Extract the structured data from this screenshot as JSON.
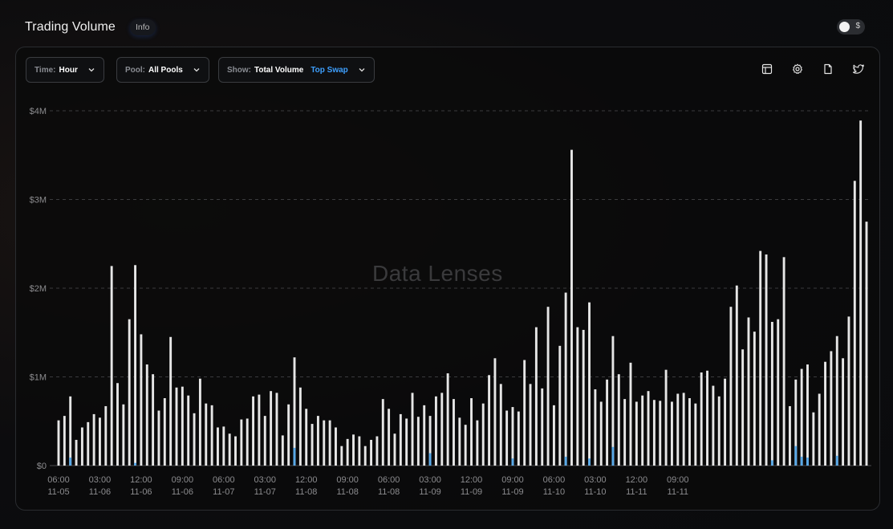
{
  "header": {
    "title": "Trading Volume",
    "info_label": "Info",
    "currency_symbol": "$"
  },
  "filters": {
    "time": {
      "label": "Time:",
      "value": "Hour"
    },
    "pool": {
      "label": "Pool:",
      "value": "All Pools"
    },
    "show": {
      "label": "Show:",
      "value": "Total Volume",
      "accent": "Top Swap"
    }
  },
  "toolbar": {
    "icons": [
      "table-icon",
      "gear-icon",
      "document-icon",
      "twitter-icon"
    ]
  },
  "watermark": "Data Lenses",
  "colors": {
    "total_volume": "#e6e6e6",
    "top_swap": "#59a9e8",
    "accent": "#3ea0ff",
    "grid": "#3b3b3e",
    "axis_text": "#8c8c8f"
  },
  "chart_data": {
    "type": "bar",
    "ylim": [
      0,
      4000000
    ],
    "yticks": [
      {
        "value": 0,
        "label": "$0"
      },
      {
        "value": 1000000,
        "label": "$1M"
      },
      {
        "value": 2000000,
        "label": "$2M"
      },
      {
        "value": 3000000,
        "label": "$3M"
      },
      {
        "value": 4000000,
        "label": "$4M"
      }
    ],
    "xticks": [
      {
        "index": 0,
        "time": "06:00",
        "date": "11-05"
      },
      {
        "index": 7,
        "time": "03:00",
        "date": "11-06"
      },
      {
        "index": 14,
        "time": "12:00",
        "date": "11-06"
      },
      {
        "index": 21,
        "time": "09:00",
        "date": "11-06"
      },
      {
        "index": 28,
        "time": "06:00",
        "date": "11-07"
      },
      {
        "index": 35,
        "time": "03:00",
        "date": "11-07"
      },
      {
        "index": 42,
        "time": "12:00",
        "date": "11-08"
      },
      {
        "index": 49,
        "time": "09:00",
        "date": "11-08"
      },
      {
        "index": 56,
        "time": "06:00",
        "date": "11-08"
      },
      {
        "index": 63,
        "time": "03:00",
        "date": "11-09"
      },
      {
        "index": 70,
        "time": "12:00",
        "date": "11-09"
      },
      {
        "index": 77,
        "time": "09:00",
        "date": "11-09"
      },
      {
        "index": 84,
        "time": "06:00",
        "date": "11-10"
      },
      {
        "index": 91,
        "time": "03:00",
        "date": "11-10"
      },
      {
        "index": 98,
        "time": "12:00",
        "date": "11-11"
      },
      {
        "index": 105,
        "time": "09:00",
        "date": "11-11"
      }
    ],
    "series": [
      {
        "name": "Total Volume",
        "values": [
          510000,
          560000,
          780000,
          290000,
          430000,
          490000,
          580000,
          540000,
          670000,
          2250000,
          930000,
          690000,
          1650000,
          2260000,
          1480000,
          1140000,
          1030000,
          620000,
          760000,
          1450000,
          880000,
          890000,
          790000,
          590000,
          980000,
          700000,
          680000,
          430000,
          440000,
          360000,
          330000,
          520000,
          530000,
          780000,
          800000,
          560000,
          840000,
          820000,
          340000,
          690000,
          1220000,
          880000,
          640000,
          470000,
          560000,
          510000,
          510000,
          430000,
          220000,
          300000,
          350000,
          330000,
          220000,
          290000,
          330000,
          750000,
          640000,
          360000,
          580000,
          530000,
          820000,
          550000,
          680000,
          560000,
          780000,
          820000,
          1040000,
          750000,
          540000,
          460000,
          760000,
          510000,
          700000,
          1020000,
          1210000,
          920000,
          620000,
          660000,
          610000,
          1190000,
          920000,
          1560000,
          870000,
          1790000,
          680000,
          1350000,
          1950000,
          3560000,
          1560000,
          1530000,
          1840000,
          860000,
          720000,
          970000,
          1460000,
          1030000,
          750000,
          1160000,
          720000,
          790000,
          840000,
          740000,
          730000,
          1080000,
          720000,
          810000,
          820000,
          760000,
          700000,
          1050000,
          1070000,
          900000,
          780000,
          980000,
          1790000,
          2030000,
          1310000,
          1670000,
          1510000,
          2420000,
          2380000,
          1620000,
          1650000,
          2350000,
          670000,
          970000,
          1090000,
          1140000,
          600000,
          810000,
          1170000,
          1290000,
          1460000,
          1210000,
          1680000,
          3210000,
          3890000,
          2750000
        ]
      },
      {
        "name": "Top Swap",
        "values": [
          0,
          0,
          90000,
          0,
          0,
          0,
          0,
          0,
          0,
          0,
          0,
          0,
          0,
          30000,
          0,
          0,
          0,
          0,
          0,
          0,
          0,
          0,
          0,
          0,
          0,
          0,
          0,
          0,
          0,
          0,
          0,
          0,
          0,
          0,
          0,
          0,
          0,
          0,
          0,
          0,
          200000,
          0,
          0,
          0,
          0,
          0,
          0,
          0,
          0,
          0,
          0,
          0,
          0,
          0,
          0,
          0,
          0,
          0,
          0,
          0,
          0,
          0,
          0,
          140000,
          0,
          0,
          0,
          0,
          0,
          0,
          0,
          0,
          0,
          0,
          0,
          0,
          0,
          80000,
          0,
          0,
          0,
          0,
          0,
          0,
          0,
          0,
          100000,
          0,
          0,
          0,
          80000,
          0,
          0,
          0,
          210000,
          0,
          0,
          0,
          0,
          0,
          0,
          0,
          0,
          0,
          0,
          0,
          0,
          0,
          0,
          0,
          0,
          0,
          0,
          0,
          0,
          0,
          0,
          0,
          0,
          0,
          0,
          60000,
          0,
          0,
          0,
          220000,
          100000,
          90000,
          0,
          0,
          0,
          0,
          110000,
          0,
          0,
          0,
          0,
          0,
          0,
          0,
          0,
          0,
          0,
          0,
          0,
          0
        ]
      }
    ]
  }
}
